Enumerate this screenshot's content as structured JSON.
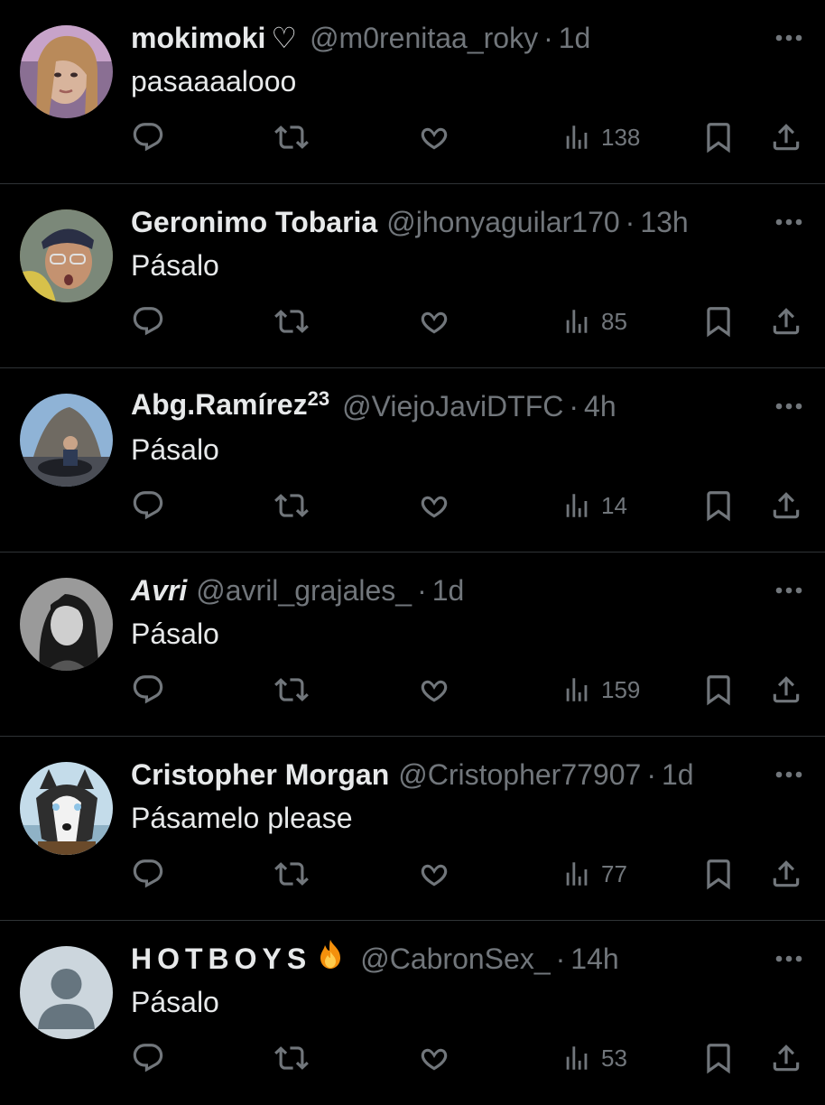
{
  "colors": {
    "background": "#000000",
    "primary_text": "#e7e9ea",
    "secondary_text": "#71767b",
    "divider": "#2f3336"
  },
  "icons": {
    "reply": "reply-icon",
    "retweet": "retweet-icon",
    "like": "heart-icon",
    "views": "views-icon",
    "bookmark": "bookmark-icon",
    "share": "share-icon",
    "more": "more-icon"
  },
  "tweets": [
    {
      "name": "mokimoki",
      "name_suffix": "♡",
      "handle": "@m0renitaa_roky",
      "time": "1d",
      "text": "pasaaaalooo",
      "views": "138"
    },
    {
      "name": "Geronimo Tobaria",
      "handle": "@jhonyaguilar170",
      "time": "13h",
      "text": "Pásalo",
      "views": "85"
    },
    {
      "name": "Abg.Ramírez",
      "name_sup": "23",
      "handle": "@ViejoJaviDTFC",
      "time": "4h",
      "text": "Pásalo",
      "views": "14"
    },
    {
      "name": "Avri",
      "handle": "@avril_grajales_",
      "time": "1d",
      "text": "Pásalo",
      "views": "159"
    },
    {
      "name": "Cristopher Morgan",
      "handle": "@Cristopher77907",
      "time": "1d",
      "text": "Pásamelo please",
      "views": "77"
    },
    {
      "name": "HOTBOYS",
      "name_emoji": "fire-emoji",
      "handle": "@CabronSex_",
      "time": "14h",
      "text": "Pásalo",
      "views": "53"
    }
  ],
  "separator": "·"
}
